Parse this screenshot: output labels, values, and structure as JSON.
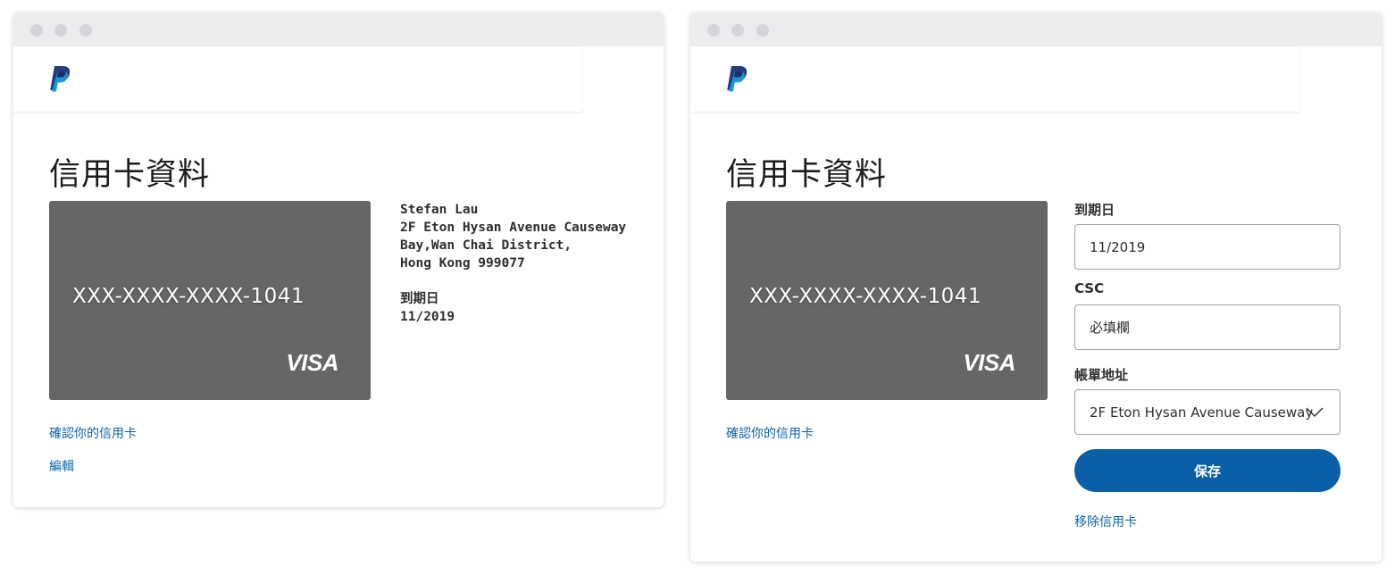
{
  "colors": {
    "accent": "#0b5fa6",
    "link": "#0c64a8",
    "card": "#666666"
  },
  "view_card": {
    "title": "信用卡資料",
    "card": {
      "number": "XXX-XXXX-XXXX-1041",
      "brand": "VISA"
    },
    "holder": {
      "name": "Stefan Lau",
      "address_lines": [
        "2F Eton Hysan Avenue Causeway",
        "Bay,Wan Chai District,",
        "Hong Kong 999077"
      ]
    },
    "expiry_label": "到期日",
    "expiry_value": "11/2019",
    "confirm_link": "確認你的信用卡",
    "edit_link": "編輯"
  },
  "edit_card": {
    "title": "信用卡資料",
    "card": {
      "number": "XXX-XXXX-XXXX-1041",
      "brand": "VISA"
    },
    "confirm_link": "確認你的信用卡",
    "expiry": {
      "label": "到期日",
      "value": "11/2019"
    },
    "csc": {
      "label": "CSC",
      "placeholder": "必填欄"
    },
    "billing": {
      "label": "帳單地址",
      "selected": "2F Eton Hysan Avenue Causeway"
    },
    "save_label": "保存",
    "remove_link": "移除信用卡"
  }
}
